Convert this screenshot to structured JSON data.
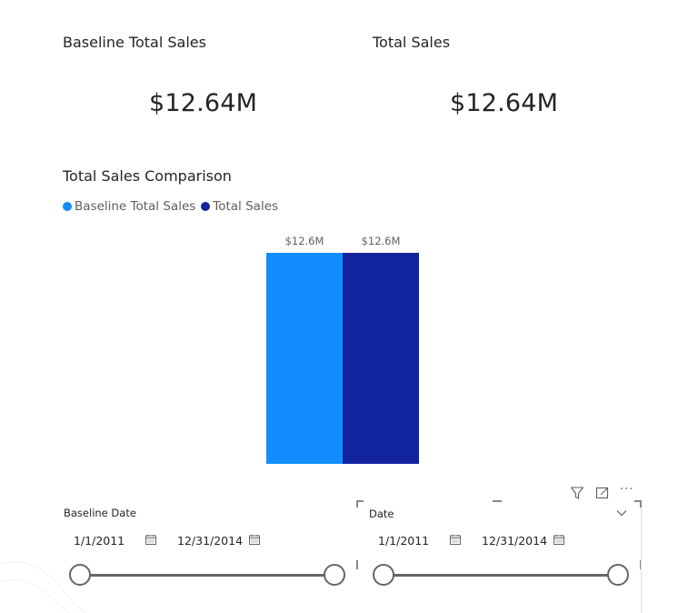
{
  "cards": [
    {
      "title": "Baseline Total Sales",
      "value": "$12.64M"
    },
    {
      "title": "Total Sales",
      "value": "$12.64M"
    }
  ],
  "chart": {
    "title": "Total Sales Comparison",
    "legend": [
      {
        "label": "Baseline Total Sales",
        "color": "#118DFF"
      },
      {
        "label": "Total Sales",
        "color": "#12239E"
      }
    ]
  },
  "chart_data": {
    "type": "bar",
    "title": "Total Sales Comparison",
    "categories": [
      ""
    ],
    "series": [
      {
        "name": "Baseline Total Sales",
        "values": [
          12.64
        ],
        "label": "$12.6M",
        "color": "#118DFF"
      },
      {
        "name": "Total Sales",
        "values": [
          12.64
        ],
        "label": "$12.6M",
        "color": "#12239E"
      }
    ],
    "unit": "$M",
    "ylim": [
      0,
      12.64
    ],
    "grid": false,
    "legend_position": "top-left"
  },
  "slicers": [
    {
      "title": "Baseline Date",
      "start": "1/1/2011",
      "end": "12/31/2014",
      "range_start": 0,
      "range_end": 1
    },
    {
      "title": "Date",
      "start": "1/1/2011",
      "end": "12/31/2014",
      "range_start": 0,
      "range_end": 1
    }
  ],
  "icons": {
    "filter": "filter-icon",
    "focus": "focus-mode-icon",
    "more": "more-options-icon",
    "calendar": "calendar-icon",
    "chevron": "chevron-down-icon"
  },
  "toolbar": {
    "more_label": "···"
  }
}
